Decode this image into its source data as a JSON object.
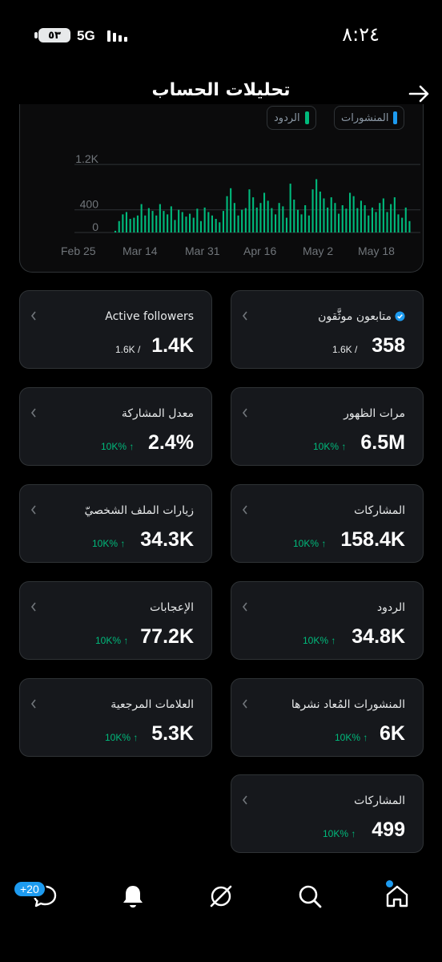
{
  "status_bar": {
    "battery": "٥٣",
    "network": "5G",
    "time": "٨:٢٤"
  },
  "header": {
    "title": "تحليلات الحساب"
  },
  "chart": {
    "legend": [
      {
        "label": "المنشورات",
        "color": "#1d9bf0"
      },
      {
        "label": "الردود",
        "color": "#00ba7c"
      }
    ]
  },
  "chart_data": {
    "type": "bar",
    "series": [
      {
        "name": "الردود",
        "values": [
          30,
          200,
          320,
          360,
          240,
          260,
          300,
          500,
          300,
          430,
          380,
          300,
          500,
          380,
          320,
          460,
          220,
          400,
          360,
          280,
          330,
          260,
          420,
          200,
          440,
          360,
          300,
          240,
          180,
          380,
          640,
          780,
          520,
          300,
          400,
          430,
          760,
          620,
          440,
          520,
          700,
          560,
          430,
          320,
          520,
          460,
          260,
          860,
          580,
          400,
          320,
          480,
          300,
          760,
          940,
          720,
          600,
          440,
          620,
          520,
          330,
          480,
          420,
          700,
          640,
          430,
          560,
          480,
          300,
          440,
          360,
          520,
          600,
          360,
          500,
          620,
          320,
          260,
          440,
          200
        ]
      }
    ],
    "y_ticks": [
      "0",
      "400",
      "1.2K"
    ],
    "x_ticks": [
      "Feb 25",
      "Mar 14",
      "Mar 31",
      "Apr 16",
      "May 2",
      "May 18"
    ],
    "ylim": [
      0,
      1300
    ],
    "grid": true
  },
  "cards": {
    "verified_followers": {
      "label": "متابعون موثَّقون",
      "value": "358",
      "sub": "1.6K /"
    },
    "active_followers": {
      "label": "Active followers",
      "value": "1.4K",
      "sub": "1.6K /"
    },
    "impressions": {
      "label": "مرات الظهور",
      "value": "6.5M",
      "sub": "10K% ↑"
    },
    "engagement_rate": {
      "label": "معدل المشاركة",
      "value": "2.4%",
      "sub": "10K% ↑"
    },
    "engagements": {
      "label": "المشاركات",
      "value": "158.4K",
      "sub": "10K% ↑"
    },
    "profile_visits": {
      "label": "زيارات الملف الشخصيّ",
      "value": "34.3K",
      "sub": "10K% ↑"
    },
    "replies": {
      "label": "الردود",
      "value": "34.8K",
      "sub": "10K% ↑"
    },
    "likes": {
      "label": "الإعجابات",
      "value": "77.2K",
      "sub": "10K% ↑"
    },
    "reposts": {
      "label": "المنشورات المُعاد نشرها",
      "value": "6K",
      "sub": "10K% ↑"
    },
    "bookmarks": {
      "label": "العلامات المرجعية",
      "value": "5.3K",
      "sub": "10K% ↑"
    },
    "shares": {
      "label": "المشاركات",
      "value": "499",
      "sub": "10K% ↑"
    }
  },
  "nav": {
    "messages_badge": "+20"
  }
}
